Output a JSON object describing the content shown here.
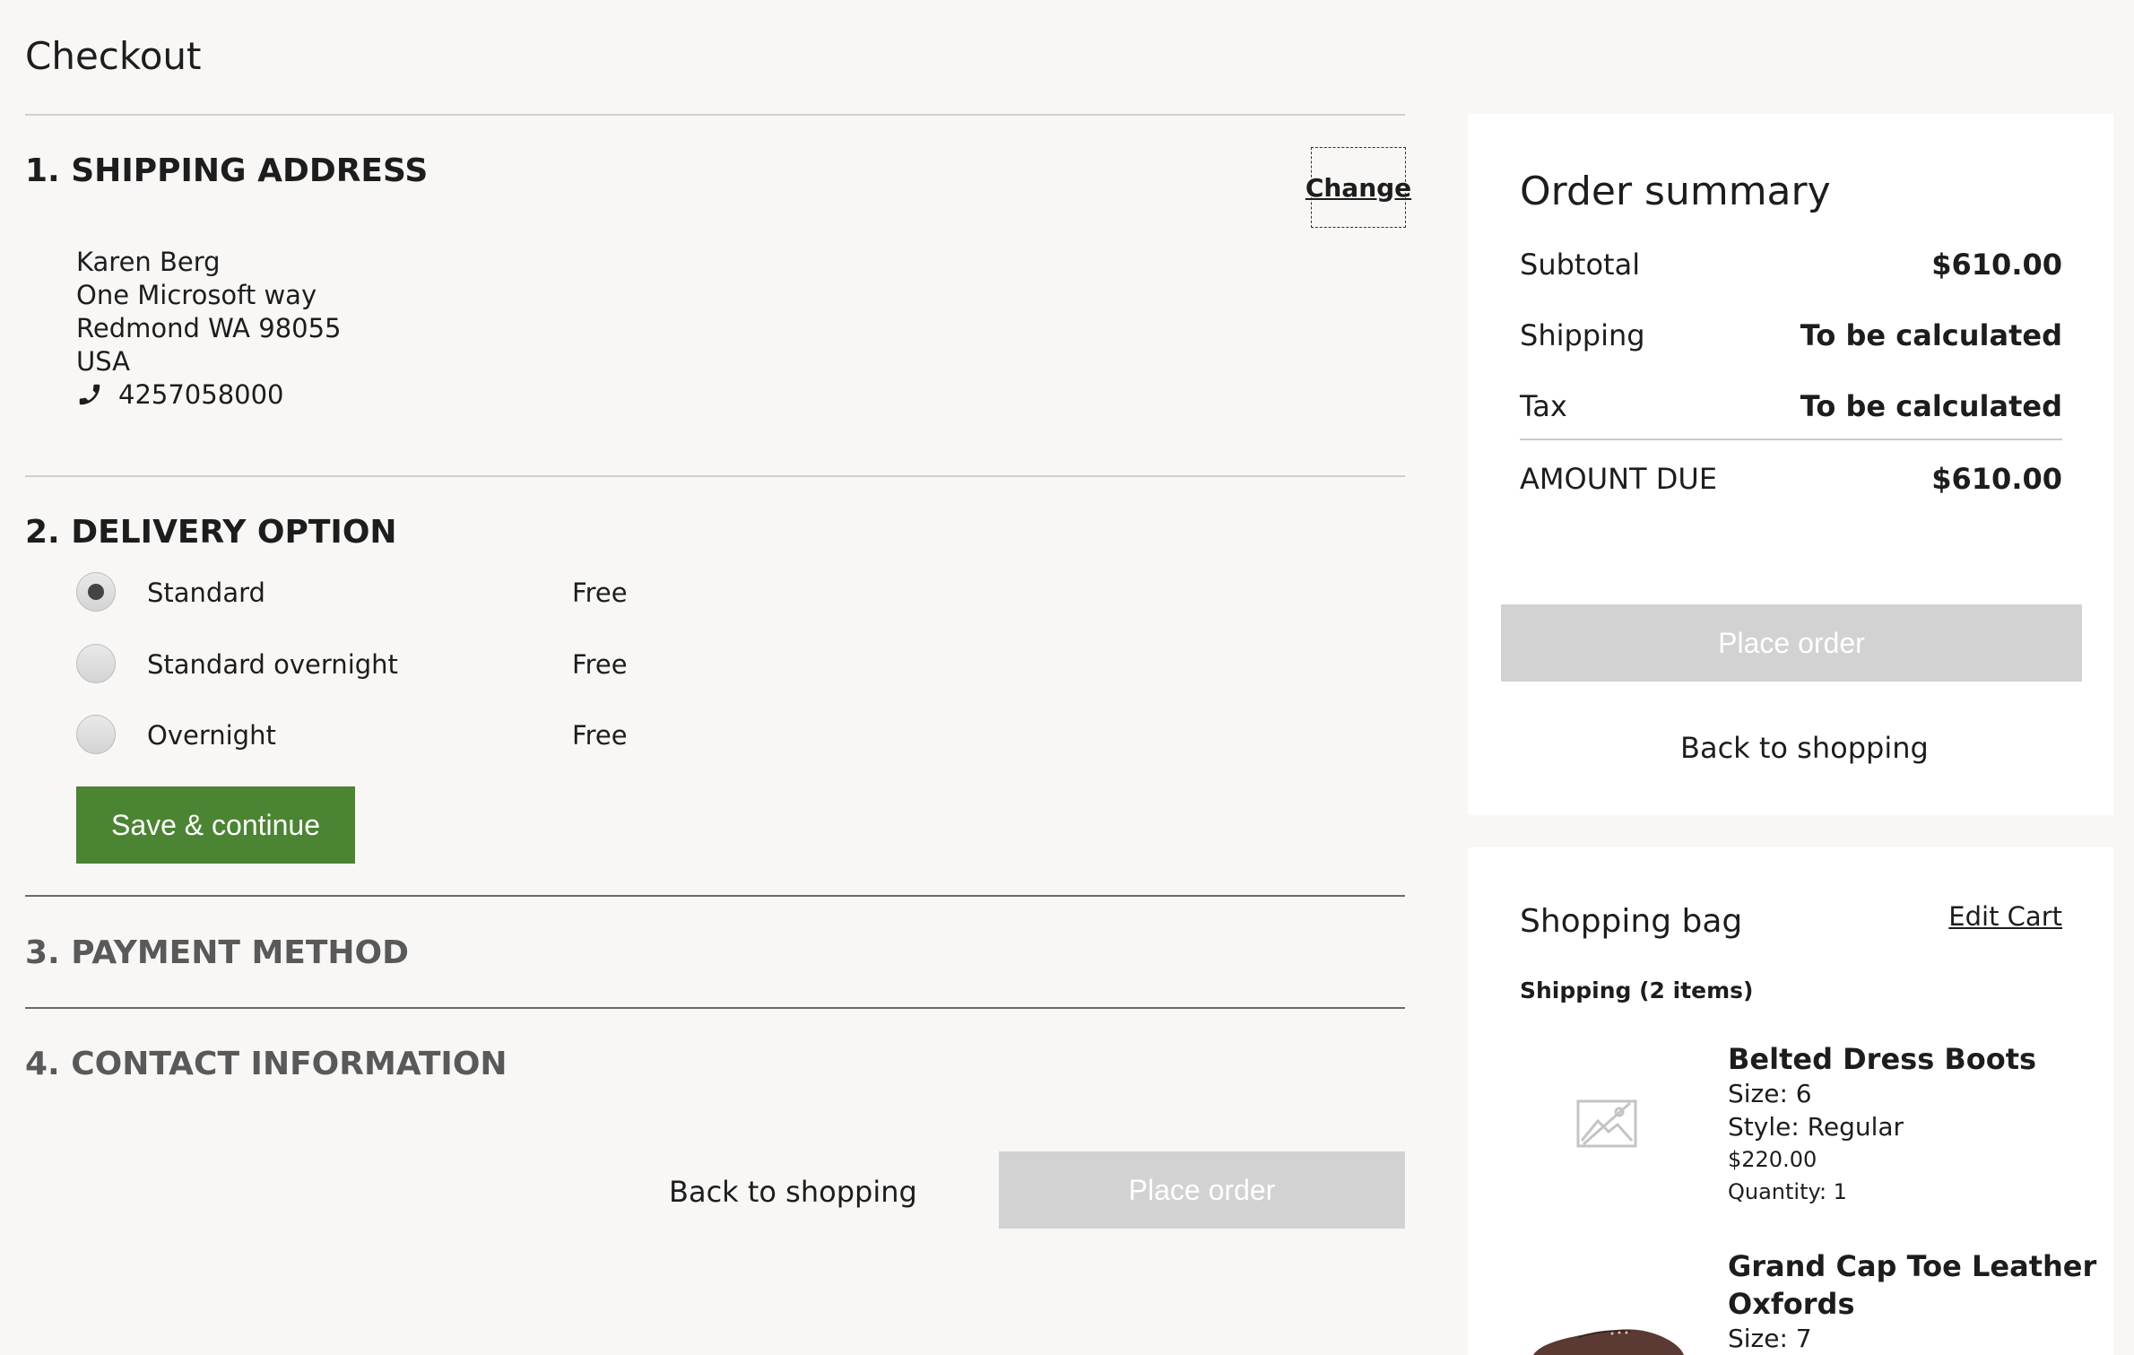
{
  "page": {
    "title": "Checkout"
  },
  "shipping": {
    "heading": "1. SHIPPING ADDRESS",
    "change_label": "Change",
    "name": "Karen Berg",
    "street": "One Microsoft way",
    "city_line": "Redmond WA  98055",
    "country": "USA",
    "phone": "4257058000",
    "phone_icon": "phone-icon"
  },
  "delivery": {
    "heading": "2. DELIVERY OPTION",
    "options": [
      {
        "label": "Standard",
        "price": "Free",
        "selected": true
      },
      {
        "label": "Standard overnight",
        "price": "Free",
        "selected": false
      },
      {
        "label": "Overnight",
        "price": "Free",
        "selected": false
      }
    ],
    "save_label": "Save & continue"
  },
  "payment": {
    "heading": "3. PAYMENT METHOD"
  },
  "contact": {
    "heading": "4. CONTACT INFORMATION"
  },
  "footer_actions": {
    "back_label": "Back to shopping",
    "place_order_label": "Place order"
  },
  "summary": {
    "title": "Order summary",
    "rows": [
      {
        "label": "Subtotal",
        "value": "$610.00"
      },
      {
        "label": "Shipping",
        "value": "To be calculated"
      },
      {
        "label": "Tax",
        "value": "To be calculated"
      }
    ],
    "amount_due_label": "AMOUNT DUE",
    "amount_due_value": "$610.00",
    "place_order_label": "Place order",
    "back_label": "Back to shopping"
  },
  "bag": {
    "title": "Shopping bag",
    "edit_label": "Edit Cart",
    "subtitle": "Shipping (2 items)",
    "items": [
      {
        "name": "Belted Dress Boots",
        "size": "Size: 6",
        "style": "Style: Regular",
        "price": "$220.00",
        "quantity": "Quantity: 1",
        "image_icon": "image-placeholder-icon"
      },
      {
        "name_line1": "Grand Cap Toe Leather",
        "name_line2": "Oxfords",
        "size": "Size: 7",
        "image_icon": "shoe-image"
      }
    ]
  },
  "colors": {
    "primary_button": "#4b8432",
    "disabled_button": "#d2d2d2",
    "background": "#f8f7f5",
    "panel": "#ffffff"
  }
}
